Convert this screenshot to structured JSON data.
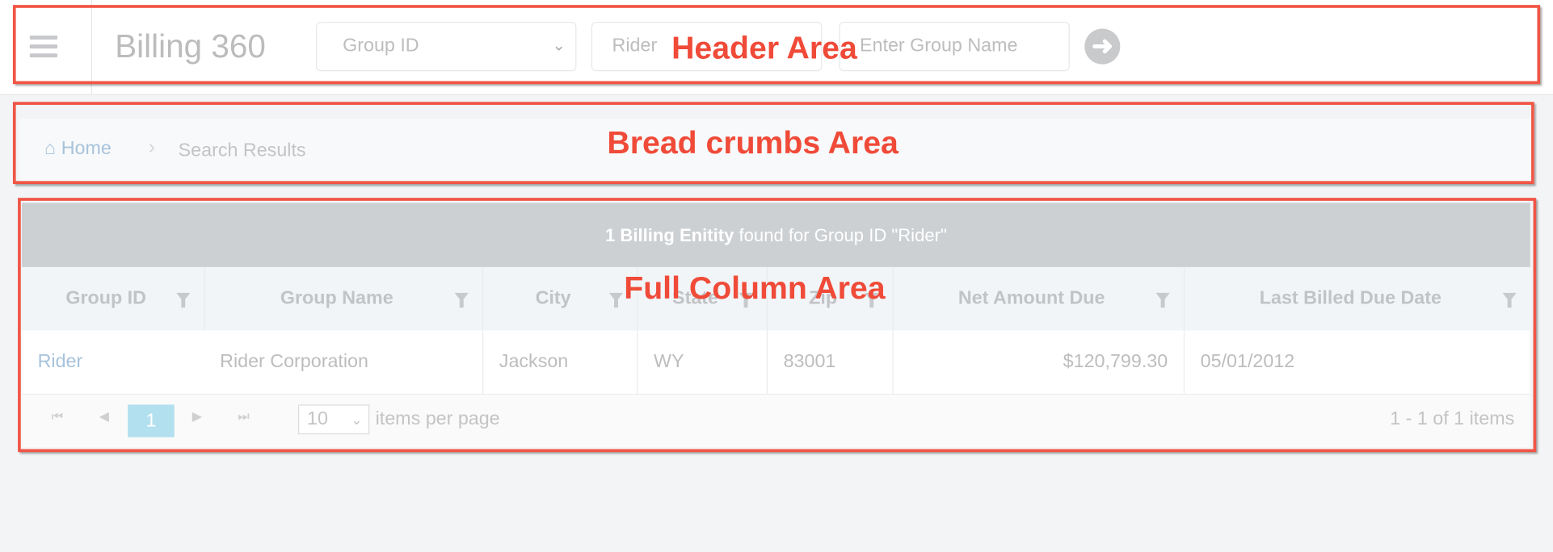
{
  "header": {
    "menu_icon": "hamburger-icon",
    "title": "Billing 360",
    "search_type": "Group ID",
    "search_value": "Rider",
    "group_name_placeholder": "Enter Group Name",
    "go_icon": "arrow-right-circle-icon"
  },
  "breadcrumb": {
    "home": "Home",
    "current": "Search Results"
  },
  "grid": {
    "summary_bold": "1 Billing Enitity",
    "summary_rest": " found for Group ID \"Rider\"",
    "columns": [
      "Group ID",
      "Group Name",
      "City",
      "State",
      "Zip",
      "Net Amount Due",
      "Last Billed Due Date"
    ],
    "rows": [
      [
        "Rider",
        "Rider Corporation",
        "Jackson",
        "WY",
        "83001",
        "$120,799.30",
        "05/01/2012"
      ]
    ],
    "pager": {
      "current_page": "1",
      "page_size": "10",
      "page_size_label": "items per page",
      "info": "1 - 1 of 1 items"
    }
  },
  "annotations": {
    "header": "Header Area",
    "breadcrumbs": "Bread crumbs Area",
    "grid": "Full Column Area",
    "color": "#f05545"
  }
}
